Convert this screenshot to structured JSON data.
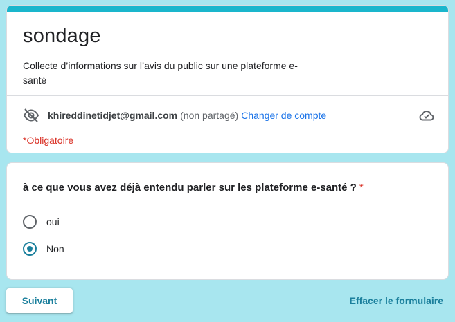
{
  "form": {
    "title": "sondage",
    "description": "Collecte d’informations sur l’avis du public sur une plateforme e-santé",
    "accent_color": "#1ab6cc",
    "background_color": "#a8e6ef"
  },
  "account": {
    "email": "khireddinetidjet@gmail.com",
    "shared_status": "(non partagé)",
    "switch_label": "Changer de compte",
    "visibility_icon": "eye-off-icon",
    "save_icon": "cloud-check-icon"
  },
  "required_note": "*Obligatoire",
  "question": {
    "text": "à ce que vous avez déjà entendu parler sur les plateforme e-santé ?",
    "required_mark": "*",
    "options": [
      {
        "label": "oui",
        "selected": false
      },
      {
        "label": "Non",
        "selected": true
      }
    ]
  },
  "actions": {
    "next_label": "Suivant",
    "clear_label": "Effacer le formulaire"
  }
}
